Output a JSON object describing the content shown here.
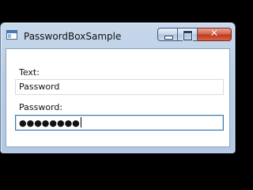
{
  "window": {
    "title": "PasswordBoxSample",
    "caption": {
      "minimize_glyph": "minimize-icon",
      "maximize_glyph": "maximize-icon",
      "close_glyph": "✕"
    }
  },
  "form": {
    "text_label": "Text:",
    "text_value": "Password",
    "password_label": "Password:",
    "password_value": "●●●●●●●●"
  },
  "colors": {
    "close_button": "#c1391c",
    "focus_border": "#3d7bad",
    "titlebar": "#b8cce4"
  }
}
